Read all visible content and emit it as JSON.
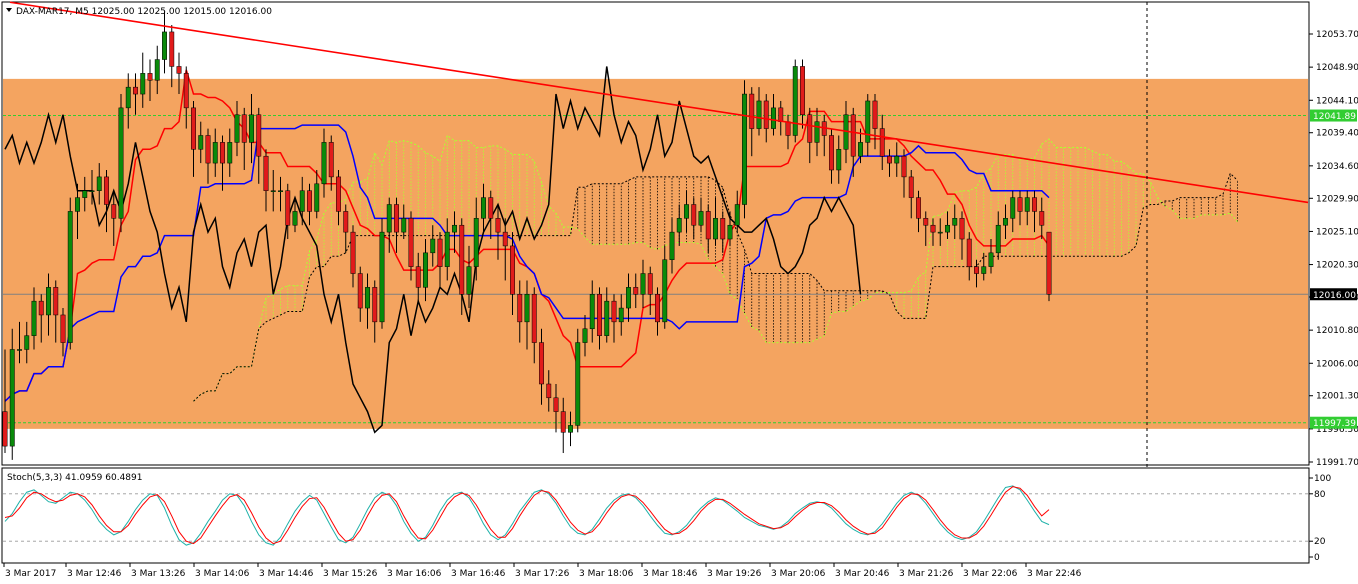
{
  "header": {
    "symbol_label": "DAX-MAR17, M5  12025.00 12025.00 12015.00 12016.00",
    "dropdown_icon": "triangle-down-icon"
  },
  "colors": {
    "zone": "#f4a460",
    "bull": "#0a8a0a",
    "bear": "#e11b1b",
    "tenkan": "#ff0000",
    "kijun": "#0000ff",
    "chikou": "#000000",
    "trendline": "#ff0000",
    "cloud_up": "#adff2f",
    "cloud_down": "#000000",
    "stoch_main": "#20b2aa",
    "stoch_signal": "#ff0000",
    "green_label": "#32cd32",
    "price_label": "#000000"
  },
  "price_axis": {
    "ticks": [
      "12053.70",
      "12048.90",
      "12044.10",
      "12039.40",
      "12034.60",
      "12029.90",
      "12025.10",
      "12020.30",
      "12015.60",
      "12010.80",
      "12006.00",
      "12001.30",
      "11996.50",
      "11991.70"
    ],
    "labels": [
      {
        "text": "12041.89",
        "value": 12041.89,
        "style": "green"
      },
      {
        "text": "12016.00",
        "value": 12016.0,
        "style": "black"
      },
      {
        "text": "11997.39",
        "value": 11997.39,
        "style": "green"
      }
    ]
  },
  "time_axis": {
    "labels": [
      "3 Mar 2017",
      "3 Mar 12:46",
      "3 Mar 13:26",
      "3 Mar 14:06",
      "3 Mar 14:46",
      "3 Mar 15:26",
      "3 Mar 16:06",
      "3 Mar 16:46",
      "3 Mar 17:26",
      "3 Mar 18:06",
      "3 Mar 18:46",
      "3 Mar 19:26",
      "3 Mar 20:06",
      "3 Mar 20:46",
      "3 Mar 21:26",
      "3 Mar 22:06",
      "3 Mar 22:46"
    ]
  },
  "stoch": {
    "label": "Stoch(5,3,3) 41.0959 60.4891",
    "levels": [
      "100",
      "80",
      "20",
      "0"
    ]
  },
  "chart_data": {
    "type": "candlestick",
    "symbol": "DAX-MAR17",
    "timeframe": "M5",
    "ylim": [
      11991.7,
      12058.5
    ],
    "zone": [
      11996.5,
      12047.2
    ],
    "trendline": {
      "from": 12058.3,
      "to": 12029.3
    },
    "candles": [
      [
        11999,
        11994,
        12008,
        11993
      ],
      [
        11994,
        12008,
        12011,
        11992
      ],
      [
        12008,
        12008,
        12012,
        12006
      ],
      [
        12008,
        12010,
        12012,
        12006
      ],
      [
        12010,
        12015,
        12017,
        12008
      ],
      [
        12015,
        12013,
        12016,
        12009
      ],
      [
        12013,
        12017,
        12019,
        12010
      ],
      [
        12017,
        12013,
        12018,
        12009
      ],
      [
        12013,
        12009,
        12014,
        12007
      ],
      [
        12009,
        12028,
        12030,
        12008
      ],
      [
        12028,
        12030,
        12032,
        12024
      ],
      [
        12030,
        12031,
        12033,
        12028
      ],
      [
        12031,
        12031,
        12034,
        12029
      ],
      [
        12031,
        12033,
        12035,
        12029
      ],
      [
        12033,
        12029,
        12034,
        12025
      ],
      [
        12029,
        12027,
        12031,
        12023
      ],
      [
        12027,
        12043,
        12045,
        12025
      ],
      [
        12043,
        12046,
        12048,
        12040
      ],
      [
        12046,
        12045,
        12048,
        12042
      ],
      [
        12045,
        12048,
        12051,
        12043
      ],
      [
        12048,
        12047,
        12050,
        12044
      ],
      [
        12047,
        12050,
        12052,
        12045
      ],
      [
        12050,
        12054,
        12057,
        12048
      ],
      [
        12054,
        12049,
        12055,
        12046
      ],
      [
        12049,
        12048,
        12051,
        12045
      ],
      [
        12048,
        12043,
        12049,
        12040
      ],
      [
        12043,
        12037,
        12044,
        12033
      ],
      [
        12037,
        12039,
        12041,
        12035
      ],
      [
        12039,
        12035,
        12040,
        12032
      ],
      [
        12035,
        12038,
        12040,
        12033
      ],
      [
        12038,
        12035,
        12039,
        12031
      ],
      [
        12035,
        12038,
        12040,
        12033
      ],
      [
        12038,
        12042,
        12044,
        12036
      ],
      [
        12042,
        12038,
        12043,
        12034
      ],
      [
        12038,
        12042,
        12045,
        12035
      ],
      [
        12042,
        12036,
        12043,
        12032
      ],
      [
        12036,
        12031,
        12037,
        12028
      ],
      [
        12031,
        12031,
        12034,
        12028
      ],
      [
        12031,
        12031,
        12033,
        12028
      ],
      [
        12031,
        12026,
        12032,
        12024
      ],
      [
        12026,
        12028,
        12030,
        12025
      ],
      [
        12028,
        12031,
        12033,
        12026
      ],
      [
        12031,
        12028,
        12032,
        12026
      ],
      [
        12028,
        12032,
        12034,
        12027
      ],
      [
        12032,
        12038,
        12040,
        12030
      ],
      [
        12038,
        12033,
        12039,
        12031
      ],
      [
        12033,
        12028,
        12034,
        12026
      ],
      [
        12028,
        12025,
        12029,
        12022
      ],
      [
        12025,
        12019,
        12026,
        12017
      ],
      [
        12019,
        12014,
        12020,
        12012
      ],
      [
        12014,
        12017,
        12019,
        12011
      ],
      [
        12017,
        12012,
        12018,
        12009
      ],
      [
        12012,
        12025,
        12027,
        12011
      ],
      [
        12025,
        12029,
        12030,
        12022
      ],
      [
        12029,
        12025,
        12030,
        12022
      ],
      [
        12025,
        12027,
        12029,
        12024
      ],
      [
        12027,
        12020,
        12028,
        12018
      ],
      [
        12020,
        12017,
        12022,
        12015
      ],
      [
        12017,
        12022,
        12024,
        12015
      ],
      [
        12022,
        12024,
        12026,
        12020
      ],
      [
        12024,
        12020,
        12025,
        12017
      ],
      [
        12020,
        12025,
        12027,
        12018
      ],
      [
        12025,
        12026,
        12028,
        12022
      ],
      [
        12026,
        12016,
        12027,
        12013
      ],
      [
        12016,
        12020,
        12023,
        12014
      ],
      [
        12020,
        12027,
        12030,
        12018
      ],
      [
        12027,
        12030,
        12032,
        12025
      ],
      [
        12030,
        12027,
        12031,
        12024
      ],
      [
        12027,
        12025,
        12029,
        12021
      ],
      [
        12025,
        12023,
        12027,
        12018
      ],
      [
        12023,
        12016,
        12025,
        12013
      ],
      [
        12016,
        12012,
        12018,
        12009
      ],
      [
        12012,
        12016,
        12018,
        12008
      ],
      [
        12016,
        12009,
        12017,
        12006
      ],
      [
        12009,
        12003,
        12011,
        12000
      ],
      [
        12003,
        12001,
        12005,
        11999
      ],
      [
        12001,
        11999,
        12003,
        11996
      ],
      [
        11999,
        11996,
        12001,
        11993
      ],
      [
        11996,
        11997,
        11999,
        11994
      ],
      [
        11997,
        12009,
        12011,
        11996
      ],
      [
        12009,
        12011,
        12013,
        12007
      ],
      [
        12011,
        12016,
        12018,
        12009
      ],
      [
        12016,
        12010,
        12017,
        12008
      ],
      [
        12010,
        12015,
        12017,
        12009
      ],
      [
        12015,
        12012,
        12016,
        12009
      ],
      [
        12012,
        12014,
        12016,
        12010
      ],
      [
        12014,
        12017,
        12019,
        12012
      ],
      [
        12017,
        12016,
        12019,
        12014
      ],
      [
        12016,
        12019,
        12021,
        12014
      ],
      [
        12019,
        12016,
        12020,
        12013
      ],
      [
        12016,
        12012,
        12017,
        12010
      ],
      [
        12012,
        12021,
        12023,
        12011
      ],
      [
        12021,
        12025,
        12027,
        12019
      ],
      [
        12025,
        12027,
        12029,
        12023
      ],
      [
        12027,
        12029,
        12031,
        12025
      ],
      [
        12029,
        12026,
        12030,
        12024
      ],
      [
        12026,
        12028,
        12030,
        12025
      ],
      [
        12028,
        12024,
        12029,
        12022
      ],
      [
        12024,
        12027,
        12030,
        12023
      ],
      [
        12027,
        12024,
        12028,
        12022
      ],
      [
        12024,
        12026,
        12028,
        12023
      ],
      [
        12026,
        12029,
        12031,
        12025
      ],
      [
        12029,
        12045,
        12047,
        12027
      ],
      [
        12045,
        12040,
        12046,
        12036
      ],
      [
        12040,
        12044,
        12046,
        12039
      ],
      [
        12044,
        12040,
        12045,
        12038
      ],
      [
        12040,
        12043,
        12045,
        12039
      ],
      [
        12043,
        12041,
        12044,
        12039
      ],
      [
        12041,
        12039,
        12042,
        12037
      ],
      [
        12039,
        12049,
        12050,
        12038
      ],
      [
        12049,
        12042,
        12050,
        12040
      ],
      [
        12042,
        12038,
        12043,
        12035
      ],
      [
        12038,
        12041,
        12043,
        12036
      ],
      [
        12041,
        12039,
        12042,
        12036
      ],
      [
        12039,
        12034,
        12040,
        12032
      ],
      [
        12034,
        12037,
        12039,
        12032
      ],
      [
        12037,
        12042,
        12044,
        12035
      ],
      [
        12042,
        12036,
        12043,
        12033
      ],
      [
        12036,
        12038,
        12040,
        12035
      ],
      [
        12038,
        12044,
        12045,
        12036
      ],
      [
        12044,
        12040,
        12045,
        12037
      ],
      [
        12040,
        12036,
        12042,
        12034
      ],
      [
        12036,
        12035,
        12037,
        12033
      ],
      [
        12035,
        12036,
        12038,
        12033
      ],
      [
        12036,
        12033,
        12037,
        12030
      ],
      [
        12033,
        12030,
        12034,
        12027
      ],
      [
        12030,
        12027,
        12031,
        12025
      ],
      [
        12027,
        12026,
        12028,
        12023
      ],
      [
        12026,
        12025,
        12027,
        12023
      ],
      [
        12025,
        12025,
        12027,
        12023
      ],
      [
        12025,
        12026,
        12028,
        12024
      ],
      [
        12026,
        12027,
        12029,
        12024
      ],
      [
        12027,
        12024,
        12028,
        12021
      ],
      [
        12024,
        12020,
        12025,
        12018
      ],
      [
        12020,
        12019,
        12021,
        12017
      ],
      [
        12019,
        12020,
        12022,
        12018
      ],
      [
        12020,
        12022,
        12024,
        12019
      ],
      [
        12022,
        12026,
        12028,
        12021
      ],
      [
        12026,
        12027,
        12029,
        12024
      ],
      [
        12027,
        12030,
        12031,
        12025
      ],
      [
        12030,
        12028,
        12031,
        12026
      ],
      [
        12028,
        12030,
        12031,
        12026
      ],
      [
        12030,
        12028,
        12031,
        12025
      ],
      [
        12028,
        12026,
        12030,
        12024
      ],
      [
        12025,
        12016,
        12025,
        12015
      ]
    ],
    "stoch_main": [
      45,
      55,
      70,
      82,
      85,
      78,
      70,
      68,
      75,
      82,
      80,
      72,
      60,
      45,
      35,
      28,
      32,
      45,
      60,
      72,
      80,
      78,
      62,
      40,
      22,
      15,
      18,
      30,
      45,
      58,
      72,
      80,
      78,
      65,
      45,
      28,
      18,
      15,
      25,
      42,
      58,
      70,
      78,
      72,
      55,
      38,
      22,
      18,
      25,
      42,
      60,
      75,
      82,
      78,
      65,
      45,
      30,
      20,
      25,
      40,
      58,
      72,
      80,
      82,
      75,
      60,
      42,
      28,
      22,
      28,
      42,
      58,
      70,
      82,
      85,
      80,
      68,
      52,
      38,
      30,
      28,
      35,
      48,
      62,
      72,
      78,
      80,
      75,
      65,
      52,
      40,
      30,
      28,
      32,
      40,
      52,
      62,
      70,
      75,
      72,
      65,
      58,
      50,
      45,
      40,
      38,
      35,
      38,
      45,
      55,
      62,
      68,
      70,
      68,
      62,
      52,
      42,
      35,
      30,
      28,
      32,
      42,
      55,
      68,
      78,
      82,
      78,
      68,
      55,
      42,
      32,
      25,
      22,
      25,
      32,
      45,
      60,
      75,
      88,
      90,
      85,
      72,
      58,
      45,
      41
    ],
    "stoch_signal": [
      50,
      52,
      62,
      75,
      82,
      80,
      74,
      70,
      72,
      78,
      80,
      76,
      66,
      52,
      40,
      32,
      32,
      40,
      54,
      66,
      76,
      79,
      70,
      52,
      32,
      20,
      17,
      24,
      38,
      52,
      65,
      76,
      79,
      72,
      56,
      38,
      24,
      17,
      20,
      34,
      50,
      64,
      74,
      75,
      63,
      46,
      30,
      20,
      22,
      34,
      52,
      68,
      78,
      80,
      70,
      52,
      36,
      24,
      23,
      34,
      50,
      66,
      76,
      81,
      78,
      66,
      50,
      35,
      25,
      25,
      36,
      52,
      66,
      78,
      84,
      82,
      72,
      58,
      44,
      34,
      29,
      32,
      42,
      56,
      68,
      76,
      79,
      77,
      69,
      58,
      46,
      35,
      29,
      30,
      36,
      46,
      58,
      67,
      73,
      73,
      68,
      61,
      54,
      48,
      42,
      39,
      36,
      37,
      42,
      51,
      59,
      66,
      69,
      69,
      65,
      57,
      47,
      39,
      33,
      29,
      30,
      37,
      50,
      63,
      74,
      80,
      79,
      72,
      60,
      47,
      36,
      28,
      24,
      24,
      29,
      39,
      53,
      68,
      82,
      89,
      87,
      78,
      64,
      52,
      60
    ]
  }
}
